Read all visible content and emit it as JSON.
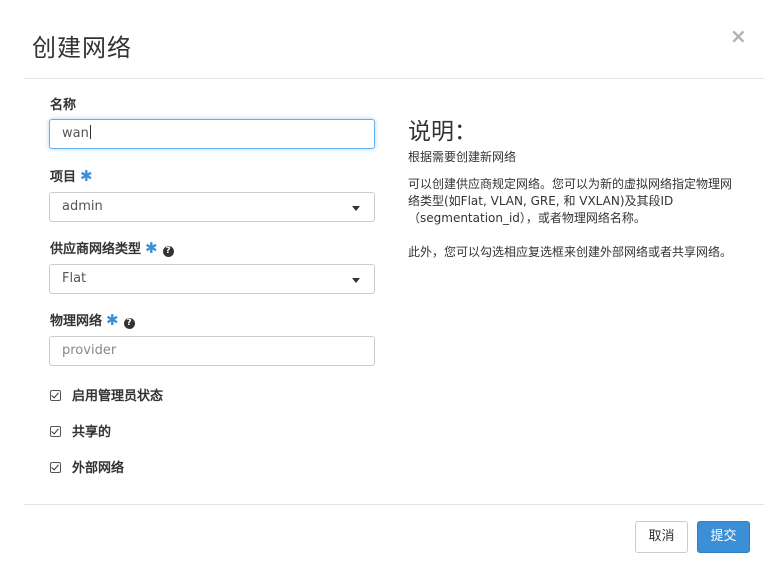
{
  "modal": {
    "title": "创建网络",
    "close_glyph": "×"
  },
  "form": {
    "name": {
      "label": "名称",
      "value": "wan"
    },
    "project": {
      "label": "项目",
      "required_mark": "✱",
      "value": "admin"
    },
    "provider_type": {
      "label": "供应商网络类型",
      "required_mark": "✱",
      "help": "?",
      "value": "Flat"
    },
    "physical_network": {
      "label": "物理网络",
      "required_mark": "✱",
      "help": "?",
      "value": "provider"
    },
    "checkboxes": [
      {
        "label": "启用管理员状态",
        "checked": true
      },
      {
        "label": "共享的",
        "checked": true
      },
      {
        "label": "外部网络",
        "checked": true
      }
    ]
  },
  "description": {
    "title": "说明：",
    "paragraphs": [
      "根据需要创建新网络",
      "可以创建供应商规定网络。您可以为新的虚拟网络指定物理网络类型(如Flat, VLAN, GRE, 和 VXLAN)及其段ID（segmentation_id），或者物理网络名称。",
      "此外，您可以勾选相应复选框来创建外部网络或者共享网络。"
    ]
  },
  "footer": {
    "cancel_label": "取消",
    "submit_label": "提交"
  },
  "colors": {
    "accent": "#3a8fd6",
    "focus_border": "#66afe9"
  },
  "icons": {
    "close": "close-icon",
    "help": "help-circle-icon",
    "checkbox": "checkbox-checked-icon",
    "dropdown": "chevron-down-icon"
  }
}
